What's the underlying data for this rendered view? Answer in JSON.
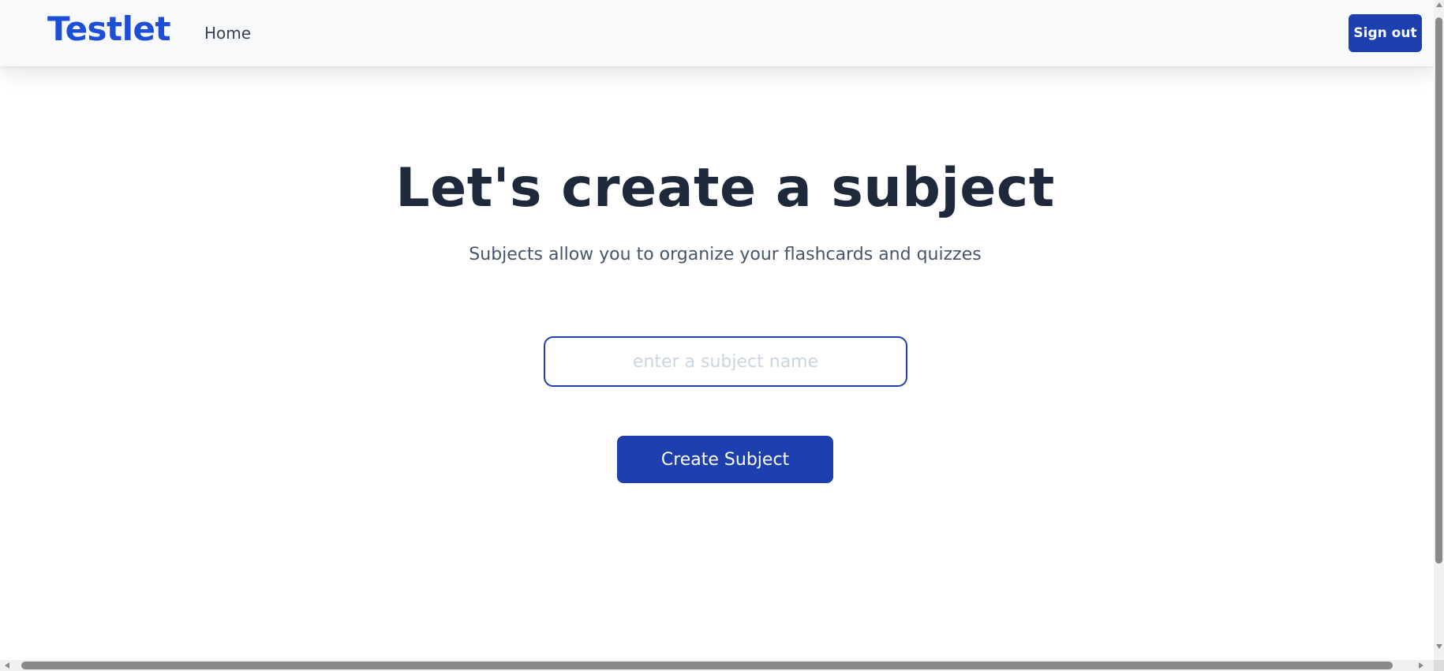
{
  "header": {
    "brand": "Testlet",
    "nav": {
      "home_label": "Home"
    },
    "sign_out_label": "Sign out"
  },
  "main": {
    "heading": "Let's create a subject",
    "subheading": "Subjects allow you to organize your flashcards and quizzes",
    "subject_input": {
      "value": "",
      "placeholder": "enter a subject name"
    },
    "create_button_label": "Create Subject"
  },
  "colors": {
    "brand": "#1d4ed8",
    "primary_button": "#1e40af",
    "heading_text": "#1e293b",
    "subtext": "#475569",
    "navbar_bg": "#f8f9fb",
    "placeholder_text": "#cbd5e1"
  },
  "icons": {
    "scroll_up": "arrow-up-icon",
    "scroll_down": "arrow-down-icon",
    "scroll_left": "arrow-left-icon",
    "scroll_right": "arrow-right-icon"
  }
}
